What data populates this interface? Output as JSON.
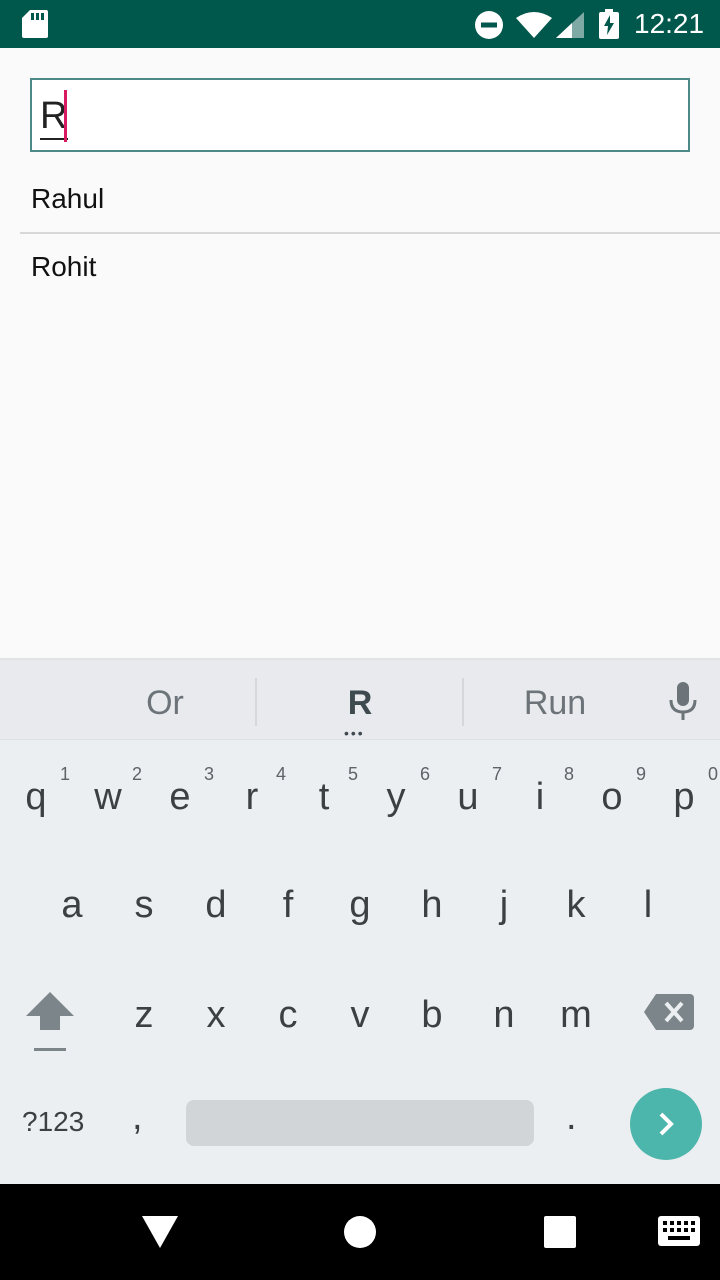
{
  "status_bar": {
    "time": "12:21",
    "icons": [
      "sd-card-icon",
      "do-not-disturb-icon",
      "wifi-icon",
      "cell-signal-icon",
      "battery-charging-icon"
    ]
  },
  "search": {
    "value": "R"
  },
  "results": [
    {
      "label": "Rahul"
    },
    {
      "label": "Rohit"
    }
  ],
  "keyboard": {
    "suggestions": [
      "Or",
      "R",
      "Run"
    ],
    "row1": [
      {
        "key": "q",
        "hint": "1"
      },
      {
        "key": "w",
        "hint": "2"
      },
      {
        "key": "e",
        "hint": "3"
      },
      {
        "key": "r",
        "hint": "4"
      },
      {
        "key": "t",
        "hint": "5"
      },
      {
        "key": "y",
        "hint": "6"
      },
      {
        "key": "u",
        "hint": "7"
      },
      {
        "key": "i",
        "hint": "8"
      },
      {
        "key": "o",
        "hint": "9"
      },
      {
        "key": "p",
        "hint": "0"
      }
    ],
    "row2": [
      "a",
      "s",
      "d",
      "f",
      "g",
      "h",
      "j",
      "k",
      "l"
    ],
    "row3": [
      "z",
      "x",
      "c",
      "v",
      "b",
      "n",
      "m"
    ],
    "symbols_label": "?123",
    "comma": ",",
    "period": "."
  },
  "colors": {
    "status_bar": "#00574b",
    "accent": "#4db6ac",
    "caret": "#d81b60"
  }
}
